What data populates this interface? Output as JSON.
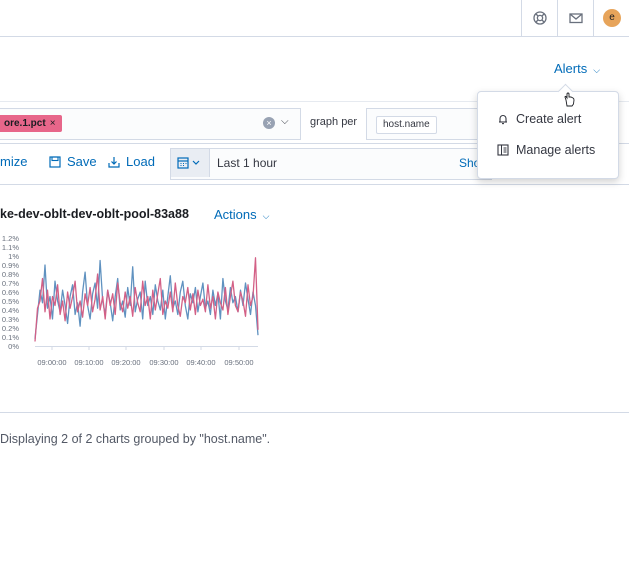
{
  "header": {
    "icons": [
      "help-icon",
      "mail-icon"
    ],
    "avatar_initial": "e",
    "avatar_color": "#e7a45a"
  },
  "alerts": {
    "label": "Alerts",
    "menu": [
      "Create alert",
      "Manage alerts"
    ]
  },
  "query": {
    "pill_label": "ore.1.pct",
    "graph_per_label": "graph per",
    "group_by_chip": "host.name"
  },
  "toolbar": {
    "customize_label": "mize",
    "save_label": "Save",
    "load_label": "Load",
    "date_range": "Last 1 hour",
    "show_label": "Sho"
  },
  "chart_panel": {
    "title": "ke-dev-oblt-dev-oblt-pool-83a88",
    "actions_label": "Actions"
  },
  "footer_text": "Displaying 2 of 2 charts grouped by \"host.name\".",
  "chart_data": {
    "type": "line",
    "title": "",
    "xlabel": "",
    "ylabel": "",
    "x_ticks": [
      "09:00:00",
      "09:10:00",
      "09:20:00",
      "09:30:00",
      "09:40:00",
      "09:50:00"
    ],
    "y_ticks": [
      "0%",
      "0.1%",
      "0.2%",
      "0.3%",
      "0.4%",
      "0.5%",
      "0.6%",
      "0.7%",
      "0.8%",
      "0.9%",
      "1%",
      "1.1%",
      "1.2%"
    ],
    "ylim": [
      0,
      1.2
    ],
    "colors": [
      "#6092c0",
      "#d36086"
    ],
    "series": [
      {
        "values": [
          0.08,
          0.35,
          0.62,
          0.48,
          0.9,
          0.42,
          0.55,
          0.3,
          0.72,
          0.5,
          0.38,
          0.62,
          0.45,
          0.25,
          0.55,
          0.68,
          0.35,
          0.48,
          0.22,
          0.6,
          0.82,
          0.45,
          0.3,
          0.58,
          0.7,
          0.42,
          0.95,
          0.5,
          0.35,
          0.62,
          0.48,
          0.28,
          0.55,
          0.75,
          0.4,
          0.5,
          0.32,
          0.65,
          0.45,
          0.88,
          0.38,
          0.52,
          0.6,
          0.3,
          0.72,
          0.45,
          0.55,
          0.35,
          0.68,
          0.5,
          0.4,
          0.62,
          0.3,
          0.55,
          0.78,
          0.42,
          0.5,
          0.35,
          0.6,
          0.72,
          0.45,
          0.3,
          0.58,
          0.48,
          0.65,
          0.38,
          0.55,
          0.7,
          0.42,
          0.5,
          0.35,
          0.62,
          0.45,
          0.58,
          0.3,
          0.75,
          0.5,
          0.4,
          0.65,
          0.48,
          0.55,
          0.38,
          0.62,
          0.45,
          0.7,
          0.52,
          0.35,
          0.6,
          0.45,
          0.12
        ]
      },
      {
        "values": [
          0.05,
          0.42,
          0.5,
          0.75,
          0.38,
          0.62,
          0.3,
          0.55,
          0.45,
          0.68,
          0.35,
          0.5,
          0.28,
          0.6,
          0.42,
          0.55,
          0.72,
          0.38,
          0.5,
          0.32,
          0.58,
          0.45,
          0.65,
          0.38,
          0.52,
          0.8,
          0.4,
          0.55,
          0.3,
          0.62,
          0.45,
          0.58,
          0.35,
          0.7,
          0.48,
          0.38,
          0.6,
          0.42,
          0.55,
          0.33,
          0.65,
          0.48,
          0.38,
          0.72,
          0.45,
          0.55,
          0.3,
          0.62,
          0.4,
          0.58,
          0.75,
          0.35,
          0.5,
          0.42,
          0.6,
          0.38,
          0.7,
          0.45,
          0.33,
          0.55,
          0.48,
          0.65,
          0.4,
          0.58,
          0.35,
          0.62,
          0.45,
          0.52,
          0.38,
          0.68,
          0.42,
          0.55,
          0.3,
          0.6,
          0.48,
          0.4,
          0.65,
          0.35,
          0.55,
          0.72,
          0.45,
          0.38,
          0.6,
          0.5,
          0.33,
          0.68,
          0.45,
          0.55,
          0.98,
          0.18
        ]
      }
    ]
  }
}
